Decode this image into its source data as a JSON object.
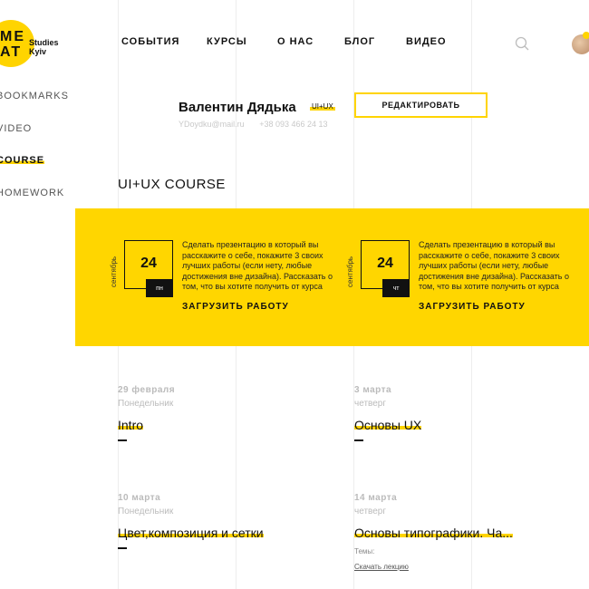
{
  "logo": {
    "mark": "ME\nAT",
    "sub": "Studies\nKyiv"
  },
  "nav": [
    "СОБЫТИЯ",
    "КУРСЫ",
    "О НАС",
    "БЛОГ",
    "ВИДЕО"
  ],
  "sidebar": [
    {
      "label": "BOOKMARKS",
      "active": false
    },
    {
      "label": "VIDEO",
      "active": false
    },
    {
      "label": "COURSE",
      "active": true
    },
    {
      "label": "HOMEWORK",
      "active": false
    }
  ],
  "profile": {
    "name": "Валентин Дядька",
    "tag": "UI+UX",
    "email": "YDoydku@mail.ru",
    "phone": "+38 093 466 24 13",
    "edit_label": "РЕДАКТИРОВАТЬ"
  },
  "course_title": "UI+UX COURSE",
  "tasks": [
    {
      "month": "сентябрь",
      "day": "24",
      "weekday": "пн",
      "text": "Сделать презентацию в который вы расскажите о себе, покажите 3 своих лучших работы (если нету, любые достижения вне дизайна). Рассказать о том, что вы хотите получить от курса",
      "upload_label": "ЗАГРУЗИТЬ РАБОТУ"
    },
    {
      "month": "сентябрь",
      "day": "24",
      "weekday": "чт",
      "text": "Сделать презентацию в который вы расскажите о себе, покажите 3 своих лучших работы (если нету, любые достижения вне дизайна). Рассказать о том, что вы хотите получить от курса",
      "upload_label": "ЗАГРУЗИТЬ РАБОТУ"
    }
  ],
  "lessons": [
    {
      "date": "29 февраля",
      "weekday": "Понедельник",
      "title": "Intro"
    },
    {
      "date": "3 марта",
      "weekday": "четверг",
      "title": "Основы UX"
    },
    {
      "date": "10 марта",
      "weekday": "Понедельник",
      "title": "Цвет,композиция и сетки"
    },
    {
      "date": "14 марта",
      "weekday": "четверг",
      "title": "Основы типографики. Ча...",
      "topics_label": "Темы:",
      "download_label": "Скачать лекцию"
    }
  ],
  "colors": {
    "accent": "#ffd400",
    "text": "#111111",
    "muted": "#bbbbbb"
  }
}
